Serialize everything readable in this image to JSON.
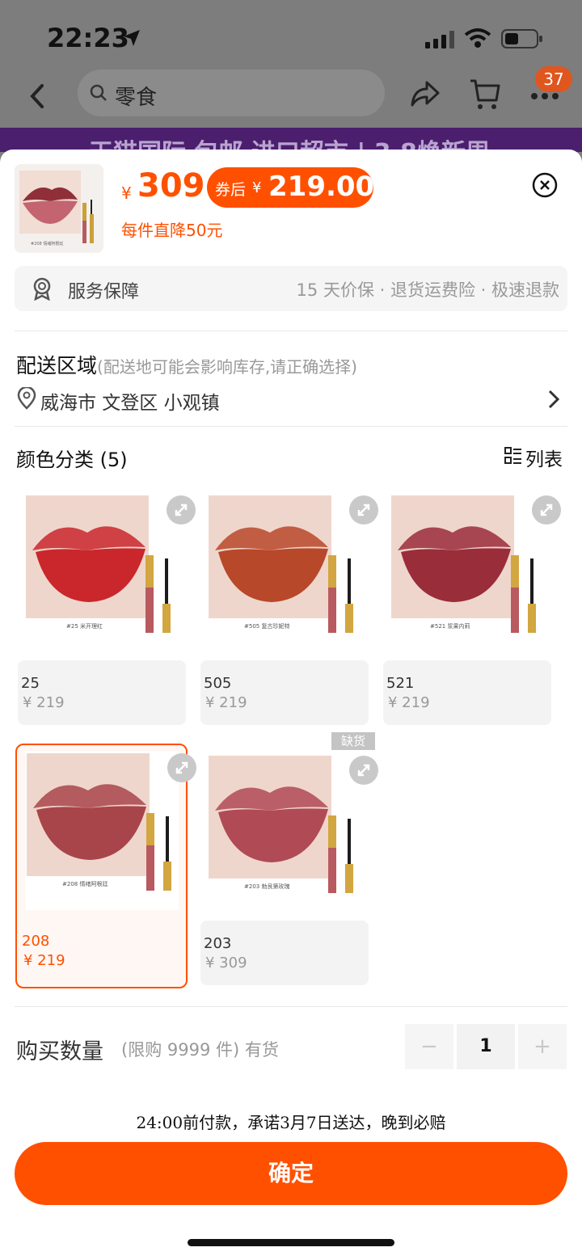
{
  "status_bar": {
    "time": "22:23"
  },
  "nav": {
    "search_text": "零食",
    "cart_badge": "37"
  },
  "promo": {
    "text": "天猫国际 包邮 进口超市 | 3.8焕新周"
  },
  "product": {
    "price_currency": "¥",
    "price": "309",
    "coupon_label": "券后",
    "coupon_currency": "¥",
    "coupon_price": "219.00",
    "discount_note": "每件直降50元"
  },
  "service": {
    "title": "服务保障",
    "detail": "15 天价保 · 退货运费险 · 极速退款"
  },
  "shipping": {
    "title": "配送区域",
    "note": "(配送地可能会影响库存,请正确选择)",
    "address": "威海市 文登区 小观镇"
  },
  "color": {
    "title": "颜色分类 (5)",
    "list_label": "列表",
    "options": [
      {
        "name": "25",
        "price": "¥ 219",
        "img_label": "#25 米开理红",
        "color": "#c9272c"
      },
      {
        "name": "505",
        "price": "¥ 219",
        "img_label": "#505 复古珍妮特",
        "color": "#b8482a"
      },
      {
        "name": "521",
        "price": "¥ 219",
        "img_label": "#521 浆果内莉",
        "color": "#9a2d3a"
      },
      {
        "name": "208",
        "price": "¥ 219",
        "img_label": "#208 情绪阿根廷",
        "color": "#a8454b"
      },
      {
        "name": "203",
        "price": "¥ 309",
        "img_label": "#203 勃艮第玫瑰",
        "color": "#b04a55"
      }
    ],
    "out_of_stock": "缺货"
  },
  "quantity": {
    "title": "购买数量",
    "note": "(限购 9999 件) 有货",
    "value": "1",
    "minus": "−",
    "plus": "+"
  },
  "delivery_note": "24:00前付款，承诺3月7日送达，晚到必赔",
  "confirm_label": "确定",
  "thumb_label": "#208 情绪阿根廷",
  "colors": {
    "accent": "#ff5000"
  }
}
